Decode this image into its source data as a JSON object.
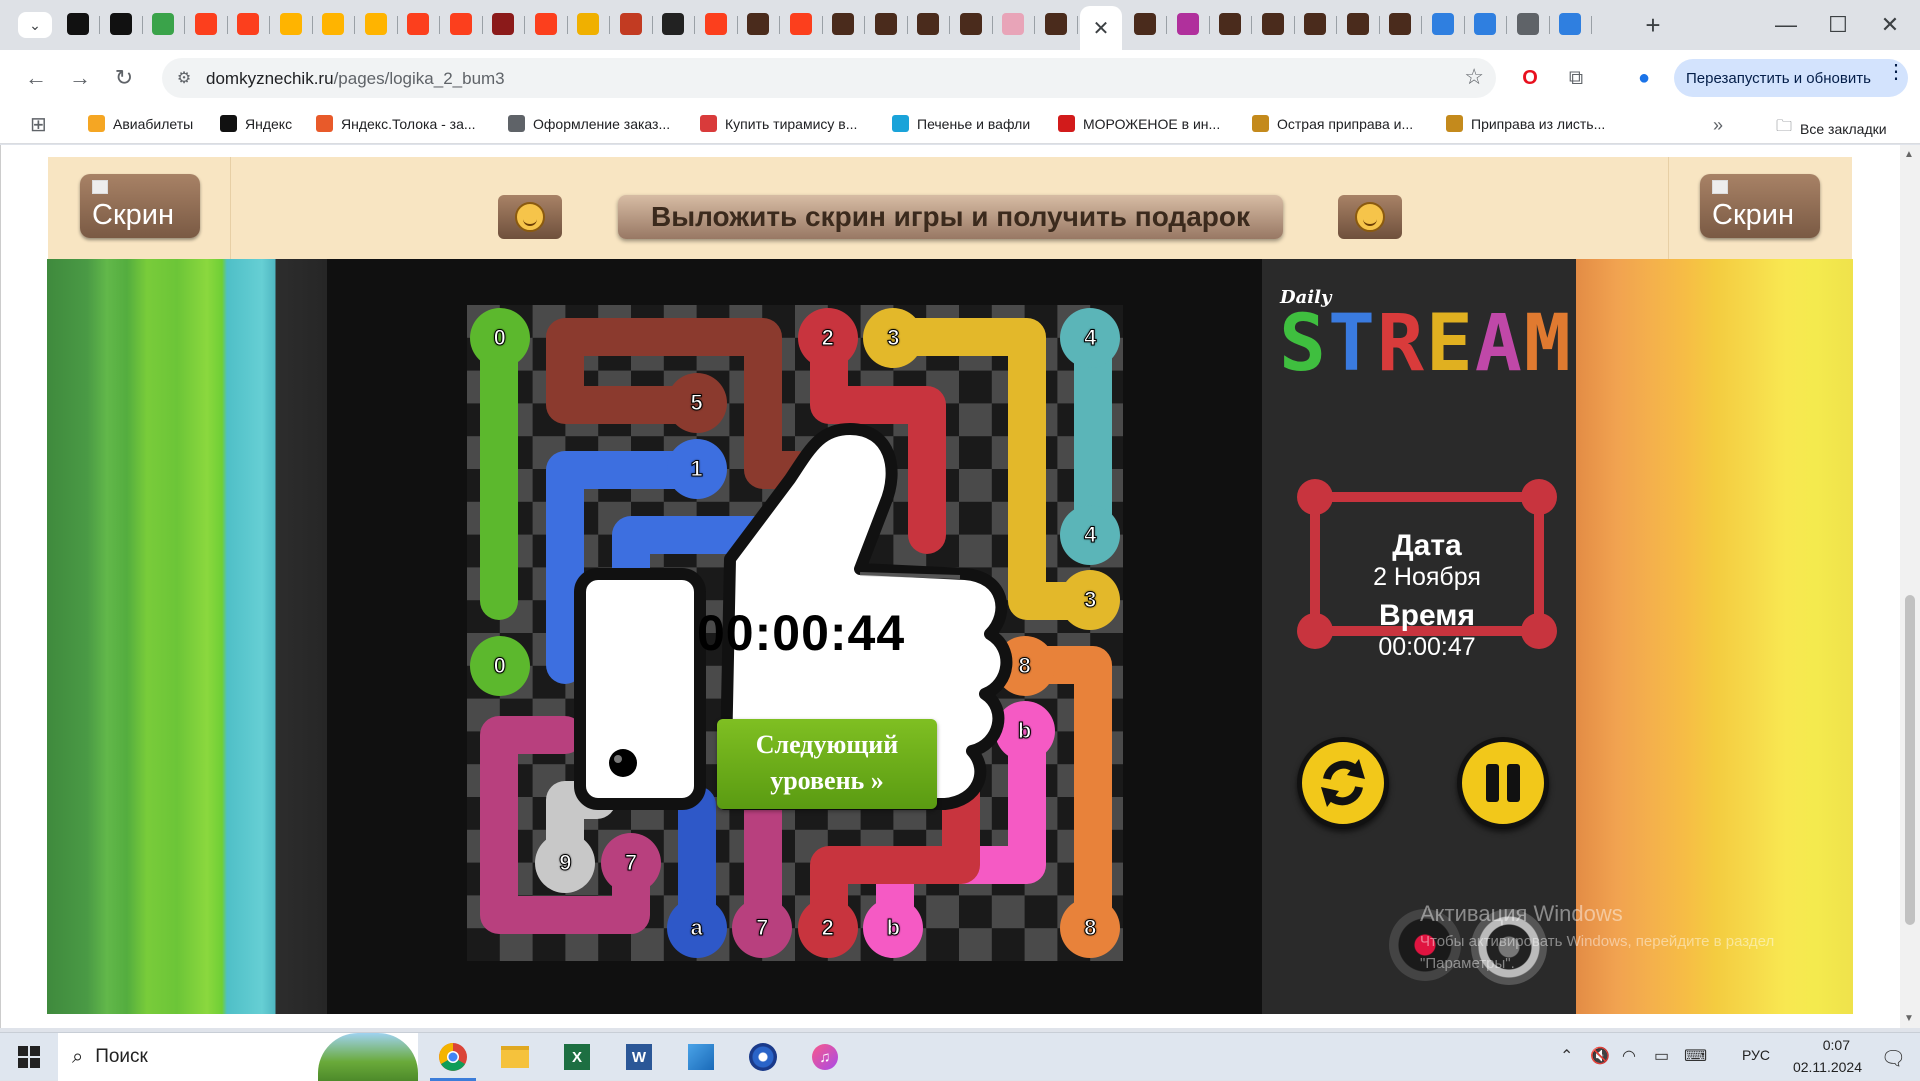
{
  "browser": {
    "url_host": "domkyznechik.ru",
    "url_path": "/pages/logika_2_bum3",
    "relaunch_label": "Перезапустить и обновить",
    "tabs": [
      {
        "icon": "chatgpt-icon",
        "color": "#111111"
      },
      {
        "icon": "chatgpt-icon",
        "color": "#111111"
      },
      {
        "icon": "leaf-icon",
        "color": "#3aa34a"
      },
      {
        "icon": "yandex-icon",
        "color": "#fc3f1d"
      },
      {
        "icon": "yandex-icon",
        "color": "#fc3f1d"
      },
      {
        "icon": "market-icon",
        "color": "#ffb400"
      },
      {
        "icon": "market-icon",
        "color": "#ffb400"
      },
      {
        "icon": "market-icon",
        "color": "#ffb400"
      },
      {
        "icon": "yandex-icon",
        "color": "#fc3f1d"
      },
      {
        "icon": "yandex-icon",
        "color": "#fc3f1d"
      },
      {
        "icon": "image-icon",
        "color": "#8b1a1a"
      },
      {
        "icon": "yandex-icon",
        "color": "#fc3f1d"
      },
      {
        "icon": "image-icon",
        "color": "#f0b000"
      },
      {
        "icon": "image-icon",
        "color": "#c23b22"
      },
      {
        "icon": "b-icon",
        "color": "#222222"
      },
      {
        "icon": "yandex-icon",
        "color": "#fc3f1d"
      },
      {
        "icon": "game-icon",
        "color": "#4a2b1c"
      },
      {
        "icon": "yandex-icon",
        "color": "#fc3f1d"
      },
      {
        "icon": "game-icon",
        "color": "#4a2b1c"
      },
      {
        "icon": "game-icon",
        "color": "#4a2b1c"
      },
      {
        "icon": "game-icon",
        "color": "#4a2b1c"
      },
      {
        "icon": "game-icon",
        "color": "#4a2b1c"
      },
      {
        "icon": "image-icon",
        "color": "#e8a4b8"
      },
      {
        "icon": "game-icon",
        "color": "#4a2b1c"
      }
    ],
    "tabs_after": [
      {
        "icon": "game-icon",
        "color": "#4a2b1c"
      },
      {
        "icon": "image-icon",
        "color": "#b0309c"
      },
      {
        "icon": "game-icon",
        "color": "#4a2b1c"
      },
      {
        "icon": "game-icon",
        "color": "#4a2b1c"
      },
      {
        "icon": "game-icon",
        "color": "#4a2b1c"
      },
      {
        "icon": "game-icon",
        "color": "#4a2b1c"
      },
      {
        "icon": "game-icon",
        "color": "#4a2b1c"
      },
      {
        "icon": "app-icon",
        "color": "#2f7fe0"
      },
      {
        "icon": "app-icon",
        "color": "#2f7fe0"
      },
      {
        "icon": "link-icon",
        "color": "#5f6368"
      },
      {
        "icon": "app-icon",
        "color": "#2f7fe0"
      }
    ],
    "bookmarks": [
      {
        "label": "Авиабилеты",
        "icon": "plane-icon",
        "color": "#f5a623"
      },
      {
        "label": "Яндекс",
        "icon": "chatgpt-icon",
        "color": "#111111"
      },
      {
        "label": "Яндекс.Толока - за...",
        "icon": "toloka-icon",
        "color": "#e85a2a"
      },
      {
        "label": "Оформление заказ...",
        "icon": "globe-icon",
        "color": "#5f6368"
      },
      {
        "label": "Купить тирамису в...",
        "icon": "cake-icon",
        "color": "#d93b3b"
      },
      {
        "label": "Печенье и вафли",
        "icon": "cookie-icon",
        "color": "#1aa3d9"
      },
      {
        "label": "МОРОЖЕНОЕ в ин...",
        "icon": "d-icon",
        "color": "#d21b1b"
      },
      {
        "label": "Острая приправа и...",
        "icon": "spice-icon",
        "color": "#c48a1c"
      },
      {
        "label": "Приправа из листь...",
        "icon": "zh-icon",
        "color": "#c48a1c"
      }
    ],
    "all_bookmarks_label": "Все закладки"
  },
  "banner": {
    "skrin_label": "Скрин",
    "post_screen_label": "Выложить скрин игры и получить подарок"
  },
  "game": {
    "title_small": "Daily",
    "title_big": "STREAM",
    "title_colors": [
      "#3fbf3f",
      "#3a7be0",
      "#d93b3b",
      "#e0b020",
      "#c048a8",
      "#e07a30"
    ],
    "date_label": "Дата",
    "date_value": "2 Ноября",
    "time_label": "Время",
    "time_value": "00:00:47",
    "result_time": "00:00:44",
    "next_level_label_1": "Следующий",
    "next_level_label_2": "уровень »",
    "nodes": [
      {
        "label": "0",
        "color": "#5cb82d",
        "col": 0,
        "row": 0
      },
      {
        "label": "0",
        "color": "#5cb82d",
        "col": 0,
        "row": 5
      },
      {
        "label": "5",
        "color": "#8b3a2e",
        "col": 3,
        "row": 1
      },
      {
        "label": "1",
        "color": "#3d6fe0",
        "col": 3,
        "row": 2
      },
      {
        "label": "2",
        "color": "#c8343e",
        "col": 5,
        "row": 0
      },
      {
        "label": "3",
        "color": "#e3b82a",
        "col": 6,
        "row": 0
      },
      {
        "label": "4",
        "color": "#5bb5b8",
        "col": 9,
        "row": 0
      },
      {
        "label": "4",
        "color": "#5bb5b8",
        "col": 9,
        "row": 3
      },
      {
        "label": "3",
        "color": "#e3b82a",
        "col": 9,
        "row": 4
      },
      {
        "label": "8",
        "color": "#e8823a",
        "col": 8,
        "row": 5
      },
      {
        "label": "b",
        "color": "#f55ac4",
        "col": 8,
        "row": 6
      },
      {
        "label": "9",
        "color": "#c8c8c8",
        "col": 1,
        "row": 8
      },
      {
        "label": "7",
        "color": "#b8407e",
        "col": 2,
        "row": 8
      },
      {
        "label": "a",
        "color": "#2e58c8",
        "col": 3,
        "row": 9
      },
      {
        "label": "7",
        "color": "#b8407e",
        "col": 4,
        "row": 9
      },
      {
        "label": "2",
        "color": "#c8343e",
        "col": 5,
        "row": 9
      },
      {
        "label": "b",
        "color": "#f55ac4",
        "col": 6,
        "row": 9
      },
      {
        "label": "8",
        "color": "#e8823a",
        "col": 9,
        "row": 9
      }
    ]
  },
  "activation": {
    "title": "Активация Windows",
    "text": "Чтобы активировать Windows, перейдите в раздел \"Параметры\"."
  },
  "taskbar": {
    "search_label": "Поиск",
    "lang": "РУС",
    "time": "0:07",
    "date": "02.11.2024"
  }
}
